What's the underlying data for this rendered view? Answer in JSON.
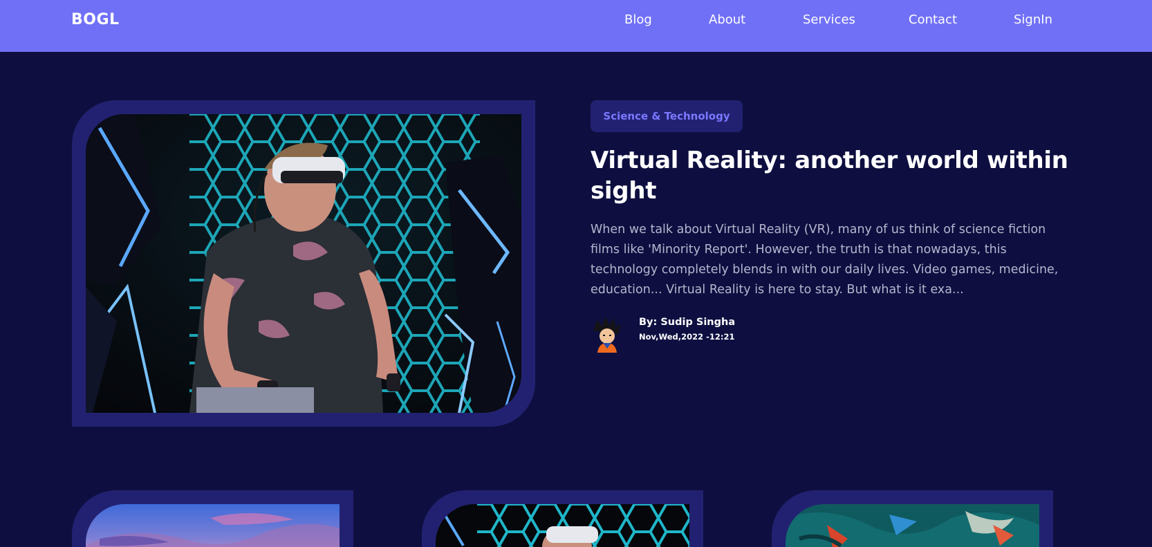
{
  "header": {
    "logo": "BOGL",
    "nav": [
      {
        "label": "Blog"
      },
      {
        "label": "About"
      },
      {
        "label": "Services"
      },
      {
        "label": "Contact"
      },
      {
        "label": "SignIn"
      }
    ]
  },
  "featured": {
    "category": "Science & Technology",
    "title": "Virtual Reality: another world within sight",
    "excerpt": "When we talk about Virtual Reality (VR), many of us think of science fiction films like 'Minority Report'. However, the truth is that nowadays, this technology completely blends in with our daily lives. Video games, medicine, education... Virtual Reality is here to stay. But what is it exa...",
    "author": "By: Sudip Singha",
    "date": "Nov,Wed,2022 -12:21",
    "image_icon": "vr-headset-photo",
    "avatar_icon": "cartoon-avatar"
  },
  "cards": [
    {
      "image_icon": "sunset-sky-photo"
    },
    {
      "image_icon": "vr-headset-photo"
    },
    {
      "image_icon": "abstract-paint-photo"
    }
  ],
  "colors": {
    "background": "#0e0f40",
    "navbar": "#7070f6",
    "frame": "#222171",
    "badge_text": "#7a78ff",
    "excerpt_text": "#b6b6cf"
  }
}
